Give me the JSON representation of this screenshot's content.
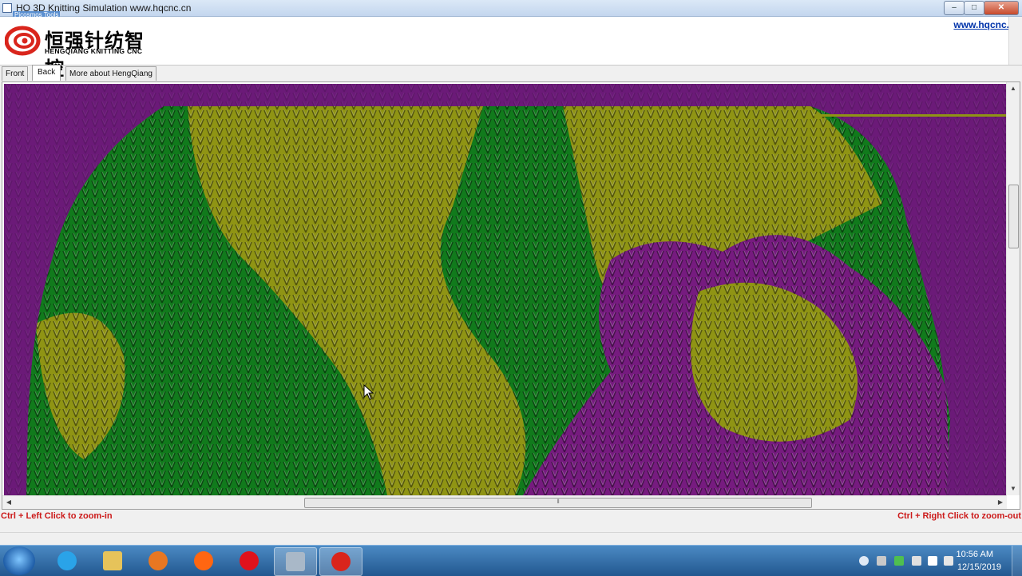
{
  "window": {
    "title": "HQ 3D Knitting Simulation     www.hqcnc.cn",
    "overlay_tag": "Picosmos Tools",
    "minimize": "–",
    "maximize": "□",
    "close": "✕"
  },
  "header": {
    "logo_cn": "恒强针纺智控",
    "logo_en": "HENGQIANG KNITTING CNC",
    "site_link": "www.hqcnc.cn"
  },
  "tabs": [
    {
      "label": "Front",
      "active": false
    },
    {
      "label": "Back",
      "active": true
    },
    {
      "label": "More about HengQiang",
      "active": false
    }
  ],
  "hints": {
    "left": "Ctrl + Left Click to zoom-in",
    "right": "Ctrl + Right Click to zoom-out"
  },
  "knit_colors": {
    "background": "#6b1a78",
    "green": "#117a1c",
    "gold": "#8f9414",
    "purple": "#761b7f"
  },
  "taskbar": {
    "items": [
      {
        "name": "internet-explorer-icon",
        "color": "#2aa3e8"
      },
      {
        "name": "file-explorer-icon",
        "color": "#e6c35a"
      },
      {
        "name": "media-player-icon",
        "color": "#e87722"
      },
      {
        "name": "firefox-icon",
        "color": "#ff6611"
      },
      {
        "name": "opera-icon",
        "color": "#e0121c"
      },
      {
        "name": "video-tool-icon",
        "color": "#a9b8c8"
      },
      {
        "name": "hengqiang-app-icon",
        "color": "#d9251c"
      }
    ],
    "time": "10:56 AM",
    "date": "12/15/2019"
  }
}
